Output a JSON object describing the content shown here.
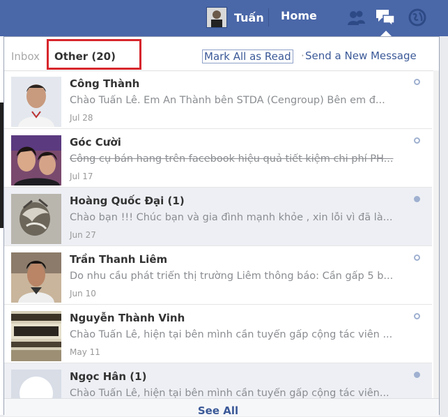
{
  "topbar": {
    "user_name": "Tuấn",
    "home_label": "Home",
    "icons": [
      "friend-requests-icon",
      "messages-icon",
      "notifications-icon"
    ]
  },
  "tabs": {
    "inbox_label": "Inbox",
    "other_label": "Other (20)"
  },
  "actions": {
    "mark_all_read": "Mark All as Read",
    "separator": "·",
    "send_new": "Send a New Message"
  },
  "messages": [
    {
      "name": "Công Thành",
      "snippet": "Chào Tuấn Lê. Em An Thành bên STDA (Cengroup) Bên em đ...",
      "time": "Jul 28",
      "unread": false
    },
    {
      "name": "Góc Cười",
      "snippet": "Công cụ bán hang trên facebook hiệu quả tiết kiệm chi phí PH...",
      "time": "Jul 17",
      "unread": false
    },
    {
      "name": "Hoàng Quốc Đại (1)",
      "snippet": "Chào bạn !!! Chúc bạn và gia đình mạnh khỏe , xin lỗi vì đã là...",
      "time": "Jun 27",
      "unread": true
    },
    {
      "name": "Trần Thanh Liêm",
      "snippet": "Do nhu cầu phát triển thị trường Liêm thông báo: Cần gấp 5 b...",
      "time": "Jun 10",
      "unread": false
    },
    {
      "name": "Nguyễn Thành Vinh",
      "snippet": "Chào Tuấn Lê, hiện tại bên mình cần tuyển gấp cộng tác viên ...",
      "time": "May 11",
      "unread": false
    },
    {
      "name": "Ngọc Hân (1)",
      "snippet": "Chào Tuấn Lê, hiện tại bên mình cần tuyển gấp cộng tác viên...",
      "time": "",
      "unread": true
    }
  ],
  "footer": {
    "see_all": "See All"
  },
  "colors": {
    "topbar": "#4a67a8",
    "link": "#3b5998",
    "unread_bg": "#edeff4",
    "highlight": "#d7262c"
  }
}
